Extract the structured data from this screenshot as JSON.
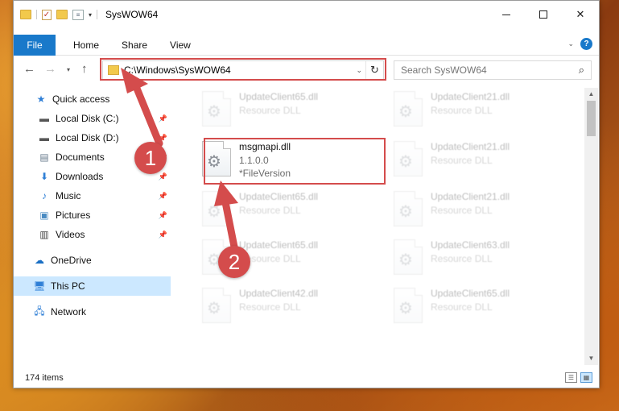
{
  "window": {
    "title": "SysWOW64"
  },
  "ribbon": {
    "tabs": [
      "File",
      "Home",
      "Share",
      "View"
    ],
    "help": "?"
  },
  "nav": {
    "address": "C:\\Windows\\SysWOW64",
    "search_placeholder": "Search SysWOW64"
  },
  "sidebar": {
    "quick_access": "Quick access",
    "items": [
      {
        "label": "Local Disk (C:)",
        "icon": "drive-icon",
        "pinned": true
      },
      {
        "label": "Local Disk (D:)",
        "icon": "drive-icon",
        "pinned": true
      },
      {
        "label": "Documents",
        "icon": "documents-icon",
        "pinned": true
      },
      {
        "label": "Downloads",
        "icon": "download-icon",
        "pinned": true
      },
      {
        "label": "Music",
        "icon": "music-icon",
        "pinned": true
      },
      {
        "label": "Pictures",
        "icon": "pictures-icon",
        "pinned": true
      },
      {
        "label": "Videos",
        "icon": "videos-icon",
        "pinned": true
      }
    ],
    "onedrive": "OneDrive",
    "this_pc": "This PC",
    "network": "Network"
  },
  "files": {
    "left": [
      {
        "name": "UpdateClient65.dll",
        "sub": "Resource DLL"
      },
      {
        "name": "msgmapi.dll",
        "sub": "1.1.0.0",
        "sub2": "*FileVersion"
      },
      {
        "name": "UpdateClient65.dll",
        "sub": "Resource DLL"
      },
      {
        "name": "UpdateClient65.dll",
        "sub": "Resource DLL"
      },
      {
        "name": "UpdateClient42.dll",
        "sub": "Resource DLL"
      }
    ],
    "right": [
      {
        "name": "UpdateClient21.dll",
        "sub": "Resource DLL"
      },
      {
        "name": "UpdateClient21.dll",
        "sub": "Resource DLL"
      },
      {
        "name": "UpdateClient21.dll",
        "sub": "Resource DLL"
      },
      {
        "name": "UpdateClient63.dll",
        "sub": "Resource DLL"
      },
      {
        "name": "UpdateClient65.dll",
        "sub": "Resource DLL"
      }
    ]
  },
  "status": {
    "count": "174 items"
  },
  "annotations": {
    "step1": "1",
    "step2": "2",
    "color": "#d44c4c"
  },
  "colors": {
    "accent": "#1979ca",
    "selection": "#cce8ff"
  }
}
